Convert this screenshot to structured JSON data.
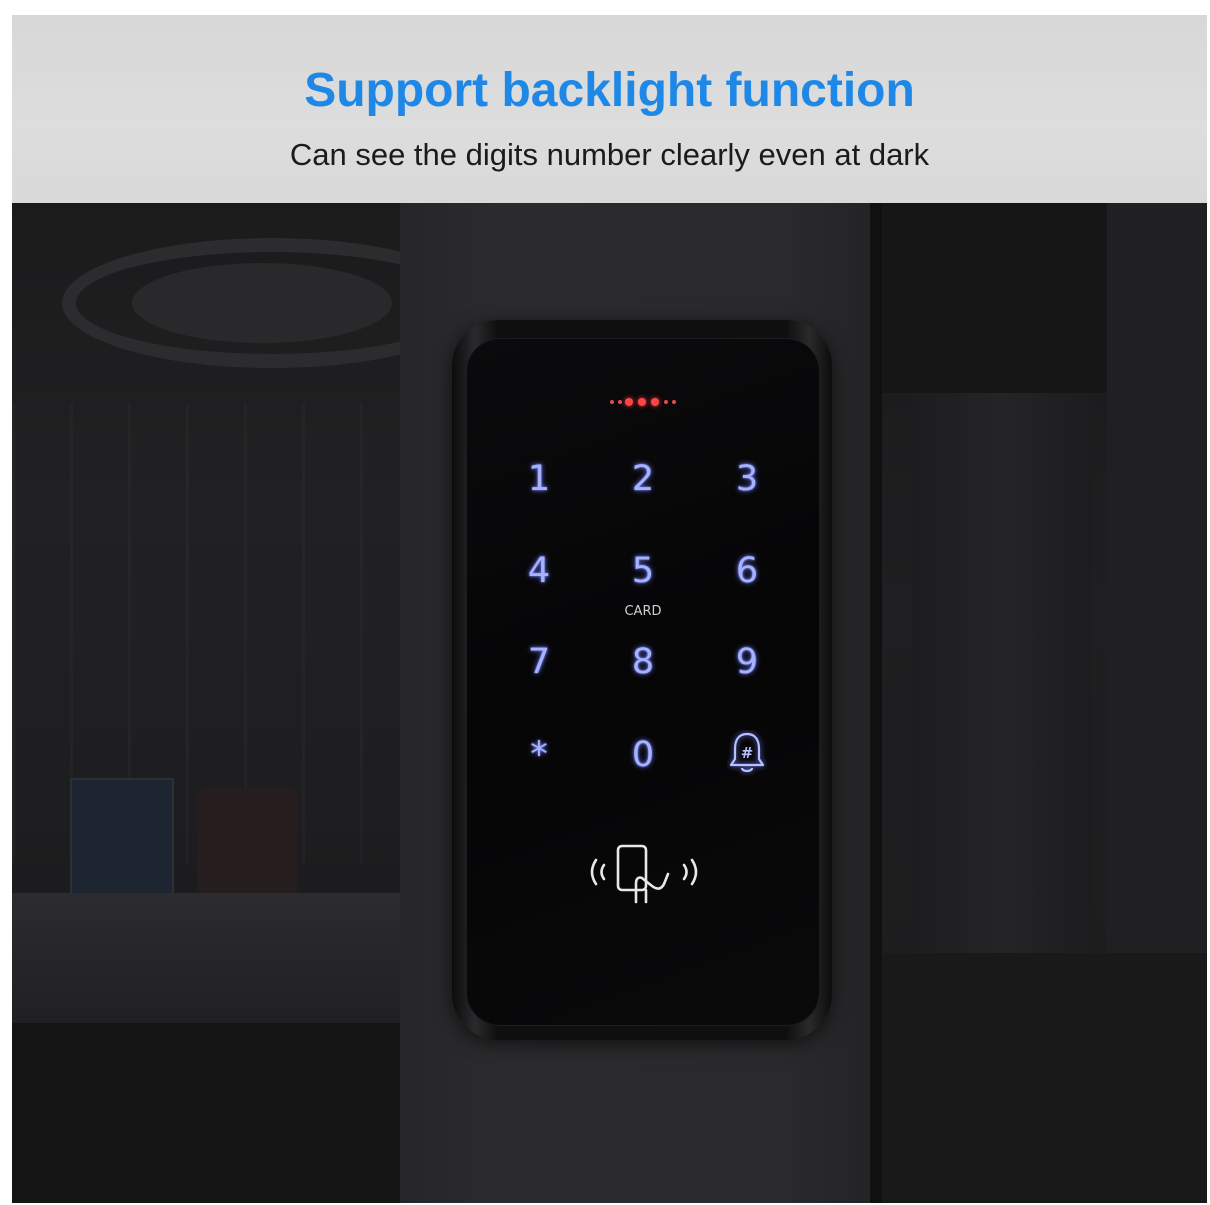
{
  "header": {
    "title": "Support backlight function",
    "subtitle": "Can see the digits number clearly even at dark"
  },
  "keypad": {
    "keys": [
      "1",
      "2",
      "3",
      "4",
      "5",
      "6",
      "7",
      "8",
      "9",
      "*",
      "0"
    ],
    "bell_key_symbol": "#",
    "card_label": "CARD",
    "backlight_color": "#a4b2ff",
    "indicator_color": "#ff4545"
  },
  "icons": {
    "bell": "bell-hash-icon",
    "rfid": "rfid-card-reader-icon",
    "indicator": "status-led-icon"
  }
}
